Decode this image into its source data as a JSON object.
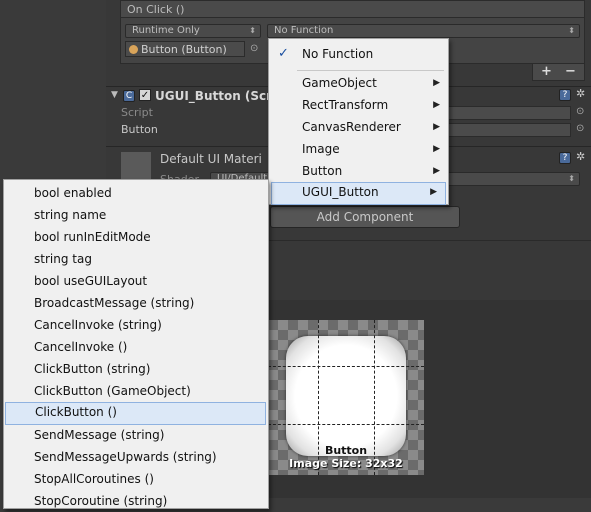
{
  "on_click": {
    "header": "On Click ()",
    "runtime_dropdown": "Runtime Only",
    "function_dropdown": "No Function",
    "object_field": "Button (Button)",
    "add_symbol": "+",
    "remove_symbol": "−"
  },
  "component": {
    "title": "UGUI_Button (Scri",
    "script_label": "Script",
    "button_label": "Button"
  },
  "material": {
    "title": "Default UI Materi",
    "shader_label": "Shader",
    "shader_value": "UI/Default"
  },
  "add_component": "Add Component",
  "function_menu": {
    "items": [
      {
        "label": "No Function",
        "checked": true,
        "submenu": false
      },
      {
        "label": "GameObject",
        "checked": false,
        "submenu": true
      },
      {
        "label": "RectTransform",
        "checked": false,
        "submenu": true
      },
      {
        "label": "CanvasRenderer",
        "checked": false,
        "submenu": true
      },
      {
        "label": "Image",
        "checked": false,
        "submenu": true
      },
      {
        "label": "Button",
        "checked": false,
        "submenu": true
      },
      {
        "label": "UGUI_Button",
        "checked": false,
        "submenu": true,
        "highlighted": true
      }
    ]
  },
  "method_menu": {
    "items": [
      "bool enabled",
      "string name",
      "bool runInEditMode",
      "string tag",
      "bool useGUILayout",
      "BroadcastMessage (string)",
      "CancelInvoke (string)",
      "CancelInvoke ()",
      "ClickButton (string)",
      "ClickButton (GameObject)",
      "ClickButton ()",
      "SendMessage (string)",
      "SendMessageUpwards (string)",
      "StopAllCoroutines ()",
      "StopCoroutine (string)"
    ],
    "selected": "ClickButton ()"
  },
  "preview": {
    "name": "Button",
    "size": "Image Size: 32x32"
  },
  "colors": {
    "menu_bg": "#f0f0f0",
    "highlight": "#dce8f7",
    "inspector_bg": "#383838"
  }
}
